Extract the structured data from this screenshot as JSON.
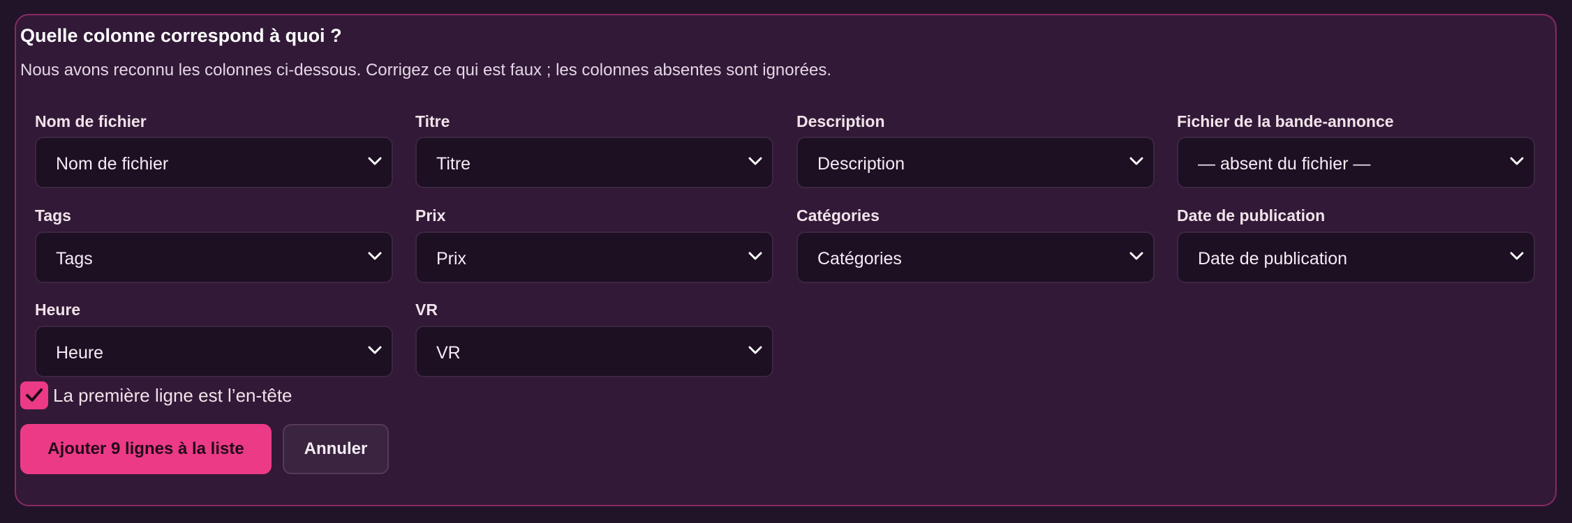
{
  "dialog": {
    "title": "Quelle colonne correspond à quoi ?",
    "subtitle": "Nous avons reconnu les colonnes ci-dessous. Corrigez ce qui est faux ; les colonnes absentes sont ignorées."
  },
  "fields": [
    {
      "label": "Nom de fichier",
      "value": "Nom de fichier"
    },
    {
      "label": "Titre",
      "value": "Titre"
    },
    {
      "label": "Description",
      "value": "Description"
    },
    {
      "label": "Fichier de la bande-annonce",
      "value": "— absent du fichier —"
    },
    {
      "label": "Tags",
      "value": "Tags"
    },
    {
      "label": "Prix",
      "value": "Prix"
    },
    {
      "label": "Catégories",
      "value": "Catégories"
    },
    {
      "label": "Date de publication",
      "value": "Date de publication"
    },
    {
      "label": "Heure",
      "value": "Heure"
    },
    {
      "label": "VR",
      "value": "VR"
    }
  ],
  "header_row": {
    "label": "La première ligne est l’en-tête",
    "checked": true
  },
  "actions": {
    "submit_label": "Ajouter 9 lignes à la liste",
    "cancel_label": "Annuler"
  },
  "colors": {
    "background": "#211429",
    "panel": "#321937",
    "panel_border": "#8a2a63",
    "accent": "#ec3a87",
    "select_bg": "#1c1022"
  },
  "icons": {
    "select": "chevron-down-icon",
    "checkbox": "checkmark-icon"
  }
}
